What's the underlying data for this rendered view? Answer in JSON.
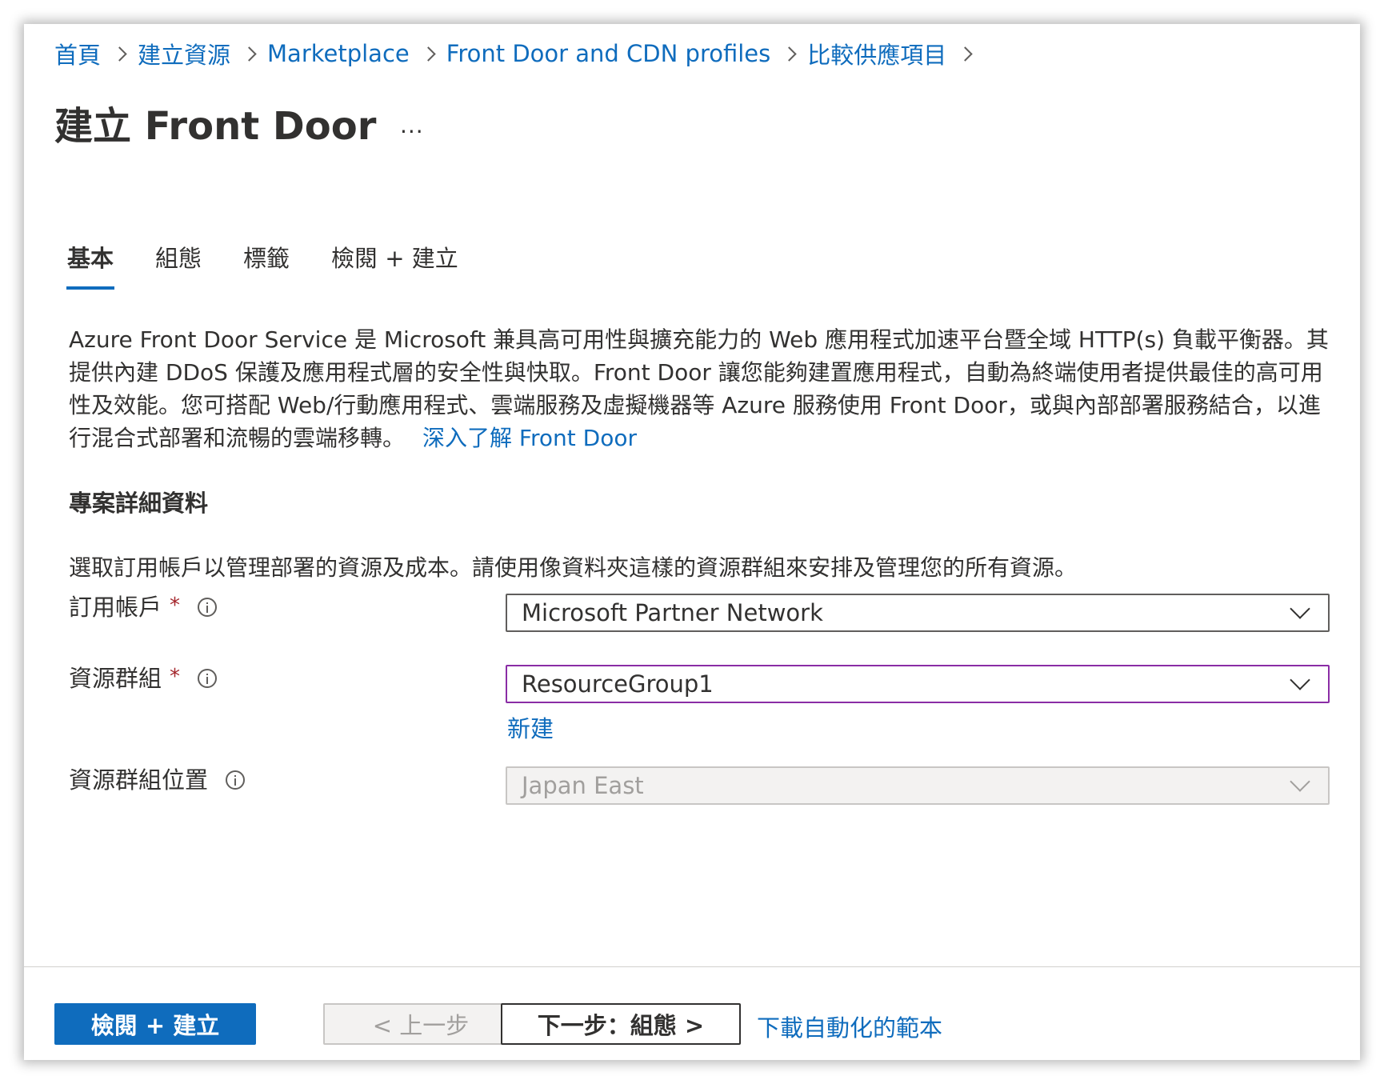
{
  "breadcrumb": {
    "items": [
      "首頁",
      "建立資源",
      "Marketplace",
      "Front Door and CDN profiles",
      "比較供應項目"
    ]
  },
  "header": {
    "title": "建立 Front Door",
    "more_label": "···"
  },
  "tabs": [
    {
      "label": "基本",
      "active": true
    },
    {
      "label": "組態",
      "active": false
    },
    {
      "label": "標籤",
      "active": false
    },
    {
      "label": "檢閱 + 建立",
      "active": false
    }
  ],
  "description": {
    "text": "Azure Front Door Service 是 Microsoft 兼具高可用性與擴充能力的 Web 應用程式加速平台暨全域 HTTP(s) 負載平衡器。其提供內建 DDoS 保護及應用程式層的安全性與快取。Front Door 讓您能夠建置應用程式，自動為終端使用者提供最佳的高可用性及效能。您可搭配 Web/行動應用程式、雲端服務及虛擬機器等 Azure 服務使用 Front Door，或與內部部署服務結合，以進行混合式部署和流暢的雲端移轉。",
    "learn_more": "深入了解 Front Door"
  },
  "project_details": {
    "title": "專案詳細資料",
    "description": "選取訂用帳戶以管理部署的資源及成本。請使用像資料夾這樣的資源群組來安排及管理您的所有資源。"
  },
  "form": {
    "subscription": {
      "label": "訂用帳戶",
      "required_mark": "*",
      "value": "Microsoft Partner Network"
    },
    "resource_group": {
      "label": "資源群組",
      "required_mark": "*",
      "value": "ResourceGroup1",
      "create_new": "新建"
    },
    "resource_group_location": {
      "label": "資源群組位置",
      "value": "Japan East"
    }
  },
  "footer": {
    "review_create": "檢閱 + 建立",
    "previous": "< 上一步",
    "next": "下一步：組態 >",
    "download_template": "下載自動化的範本"
  },
  "colors": {
    "accent": "#0f6cbd",
    "focus_border": "#8a2da5",
    "required": "#a4262c"
  }
}
